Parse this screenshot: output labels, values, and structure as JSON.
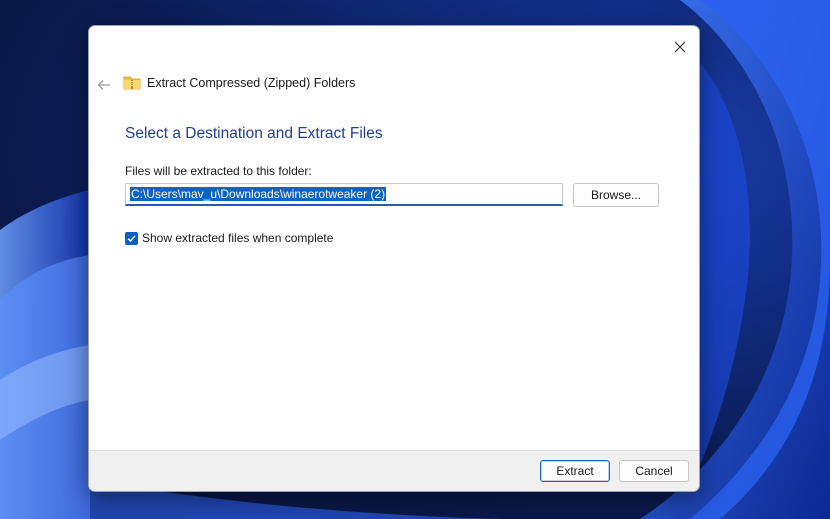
{
  "dialog": {
    "window_title": "Extract Compressed (Zipped) Folders",
    "heading": "Select a Destination and Extract Files",
    "path_label": "Files will be extracted to this folder:",
    "path_value": "C:\\Users\\mav_u\\Downloads\\winaerotweaker (2)",
    "browse_label": "Browse...",
    "checkbox_label": "Show extracted files when complete",
    "checkbox_checked": true,
    "extract_label": "Extract",
    "cancel_label": "Cancel"
  },
  "icons": {
    "close": "close-icon",
    "back": "back-arrow-icon",
    "folder": "zip-folder-icon",
    "check": "checkmark-icon"
  },
  "colors": {
    "accent": "#0a5fc4",
    "heading": "#1f3f8f",
    "footer_bg": "#f0f0f0",
    "wallpaper": "#0f2a7c"
  }
}
